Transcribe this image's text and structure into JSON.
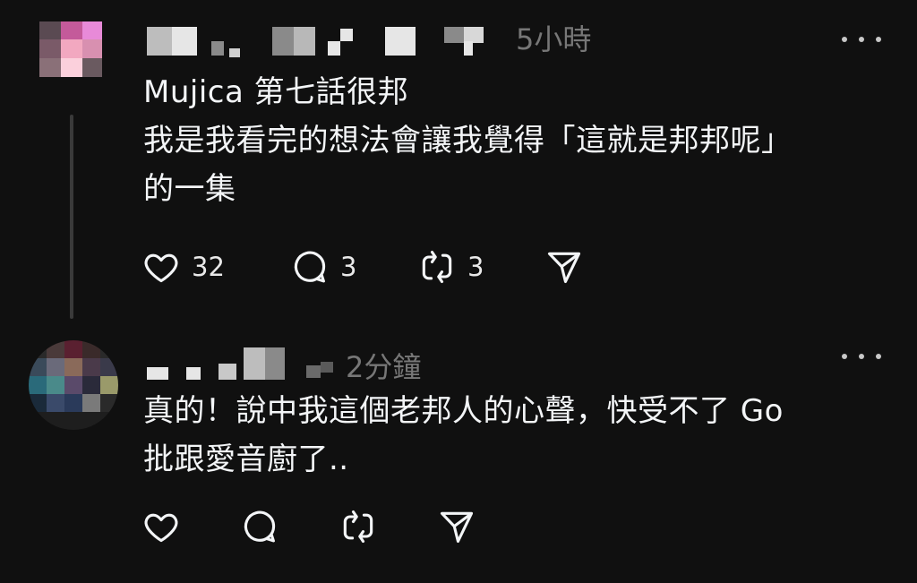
{
  "posts": [
    {
      "username": "",
      "time": "5小時",
      "lines": [
        "Mujica 第七話很邦",
        "我是我看完的想法會讓我覺得「這就是邦邦呢」",
        "的一集"
      ],
      "likes": "32",
      "replies": "3",
      "reposts": "3"
    },
    {
      "username": "",
      "time": "2分鐘",
      "lines": [
        "真的！說中我這個老邦人的心聲，快受不了 Go",
        "批跟愛音廚了.."
      ],
      "likes": "",
      "replies": "",
      "reposts": ""
    }
  ],
  "icons": {
    "like": "heart-icon",
    "reply": "comment-icon",
    "repost": "repost-icon",
    "share": "send-icon",
    "more": "more-dots-icon"
  },
  "colors": {
    "background": "#101010",
    "text": "#f3f5f7",
    "secondary": "#777777",
    "thread_line": "#3a3a3a"
  }
}
